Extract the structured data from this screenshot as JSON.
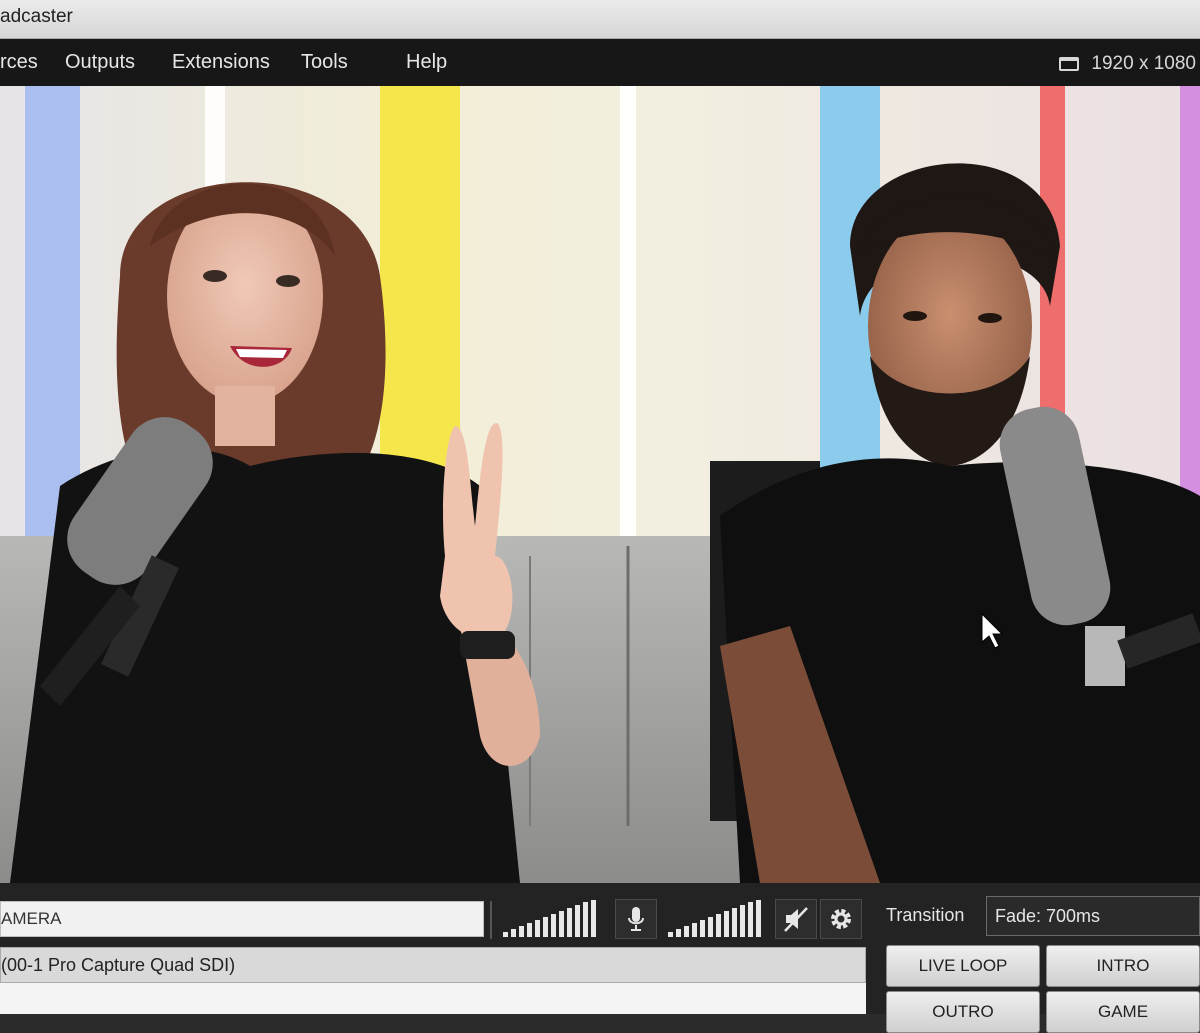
{
  "window": {
    "title": "adcaster"
  },
  "menu": {
    "items": [
      "rces",
      "Outputs",
      "Extensions",
      "Tools",
      "Help"
    ]
  },
  "resolution": {
    "label": "1920 x 1080"
  },
  "source": {
    "name": "AMERA",
    "device": "(00-1 Pro Capture Quad SDI)"
  },
  "transition": {
    "label": "Transition",
    "value": "Fade: 700ms"
  },
  "scenes": [
    "LIVE LOOP",
    "INTRO",
    "OUTRO",
    "GAME"
  ],
  "icons": {
    "mic": "microphone-icon",
    "mute": "speaker-muted-icon",
    "settings": "gear-icon",
    "display": "monitor-icon"
  },
  "colors": {
    "menubar": "#171717",
    "panel": "#232323",
    "meter": "#e8e8e8"
  }
}
